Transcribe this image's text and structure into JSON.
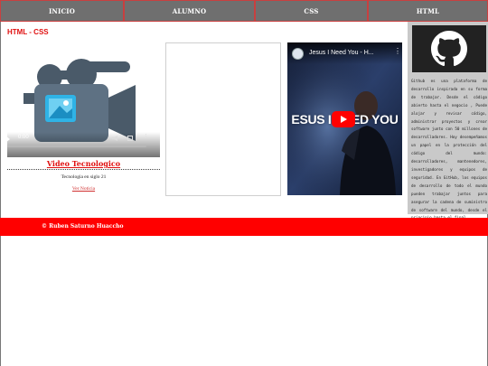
{
  "nav": {
    "items": [
      {
        "label": "INICIO"
      },
      {
        "label": "ALUMNO"
      },
      {
        "label": "CSS"
      },
      {
        "label": "HTML"
      }
    ]
  },
  "section": {
    "title": "HTML - CSS"
  },
  "video_card": {
    "player": {
      "time": "0:00",
      "icons": [
        "play-icon",
        "volume-icon",
        "fullscreen-icon",
        "more-icon"
      ]
    },
    "title": "Video Tecnologico",
    "subtitle": "Tecnologia en siglo 21",
    "link": "Ver Noticia"
  },
  "youtube": {
    "video_title": "Jesus I Need You - H...",
    "overlay_text": "ESUS I NEED YOU"
  },
  "sidebar": {
    "logo": "github-icon",
    "description": "Github es una plataforma de desarrollo inspirada en su forma de trabajar. Desde el código abierto hasta el negocio , Puede alojar y revisar código, administrar proyectos y crear software junto con 50 millones de desarrolladores. Hoy desempeñamos un papel en la protección del código del mundo: desarrolladores, mantenedores, investigadores y equipos de seguridad. En GitHub, los equipos de desarrollo de todo el mundo pueden trabajar juntos para asegurar la cadena de suministro de software del mundo, desde el principio hasta el final."
  },
  "footer": {
    "text": "© Ruben Saturno Huaccho"
  },
  "colors": {
    "accent": "#ff0000",
    "nav_bg": "#6f6f6f",
    "sidebar_bg": "#c9c9c9"
  }
}
